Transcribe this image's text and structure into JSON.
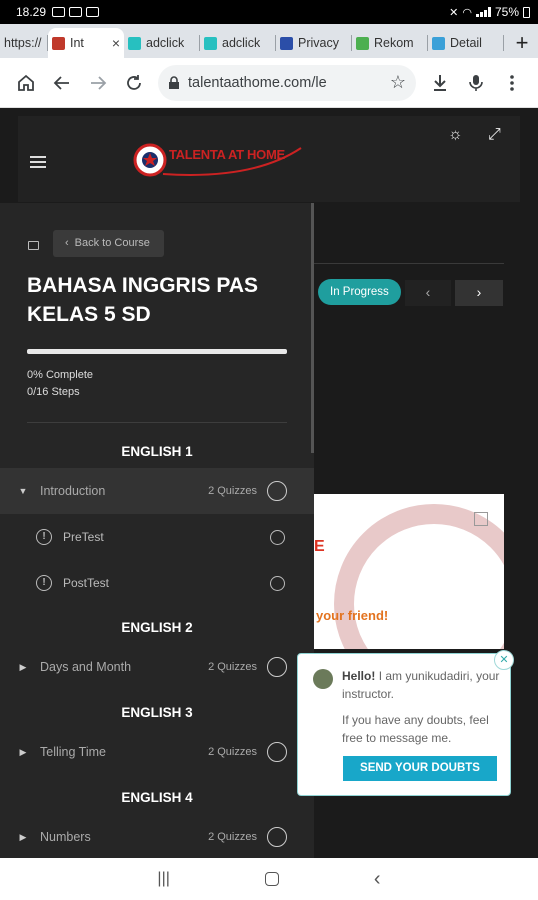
{
  "status_bar": {
    "time": "18.29",
    "battery": "75%"
  },
  "tabs": [
    {
      "title": "https://",
      "favicon_color": "#ffffff"
    },
    {
      "title": "Int",
      "favicon_color": "#c0392b",
      "active": true,
      "close": "×"
    },
    {
      "title": "adclick",
      "favicon_color": "#27c0c0"
    },
    {
      "title": "adclick",
      "favicon_color": "#27c0c0"
    },
    {
      "title": "Privacy",
      "favicon_color": "#2b4ea8"
    },
    {
      "title": "Rekom",
      "favicon_color": "#4caf50"
    },
    {
      "title": "Detail",
      "favicon_color": "#3aa0d8"
    }
  ],
  "new_tab": "+",
  "toolbar": {
    "url": "talentaathome.com/le"
  },
  "site": {
    "logo_text": "TALENTA AT HOME",
    "logo_color": "#cc2222"
  },
  "course": {
    "back_label": "Back to Course",
    "title": "BAHASA INGGRIS PAS KELAS 5 SD",
    "progress_fraction": 0,
    "percent_label": "0% Complete",
    "steps_label": "0/16 Steps"
  },
  "content": {
    "status": "In Progress",
    "prev": "‹",
    "next": "›",
    "image_caption": "your friend!"
  },
  "sections": [
    {
      "title": "ENGLISH 1",
      "lesson": {
        "name": "Introduction",
        "count": "2 Quizzes",
        "expanded": true
      },
      "quizzes": [
        "PreTest",
        "PostTest"
      ]
    },
    {
      "title": "ENGLISH 2",
      "lesson": {
        "name": "Days and Month",
        "count": "2 Quizzes"
      }
    },
    {
      "title": "ENGLISH 3",
      "lesson": {
        "name": "Telling Time",
        "count": "2 Quizzes"
      }
    },
    {
      "title": "ENGLISH 4",
      "lesson": {
        "name": "Numbers",
        "count": "2 Quizzes"
      }
    }
  ],
  "chat": {
    "hello": "Hello!",
    "intro": "I am yunikudadiri, your instructor.",
    "message": "If you have any doubts, feel free to message me.",
    "button": "SEND YOUR DOUBTS"
  },
  "colors": {
    "accent_teal": "#1f9e9e",
    "cta_blue": "#18a7c9",
    "sidebar_bg": "#262626"
  }
}
